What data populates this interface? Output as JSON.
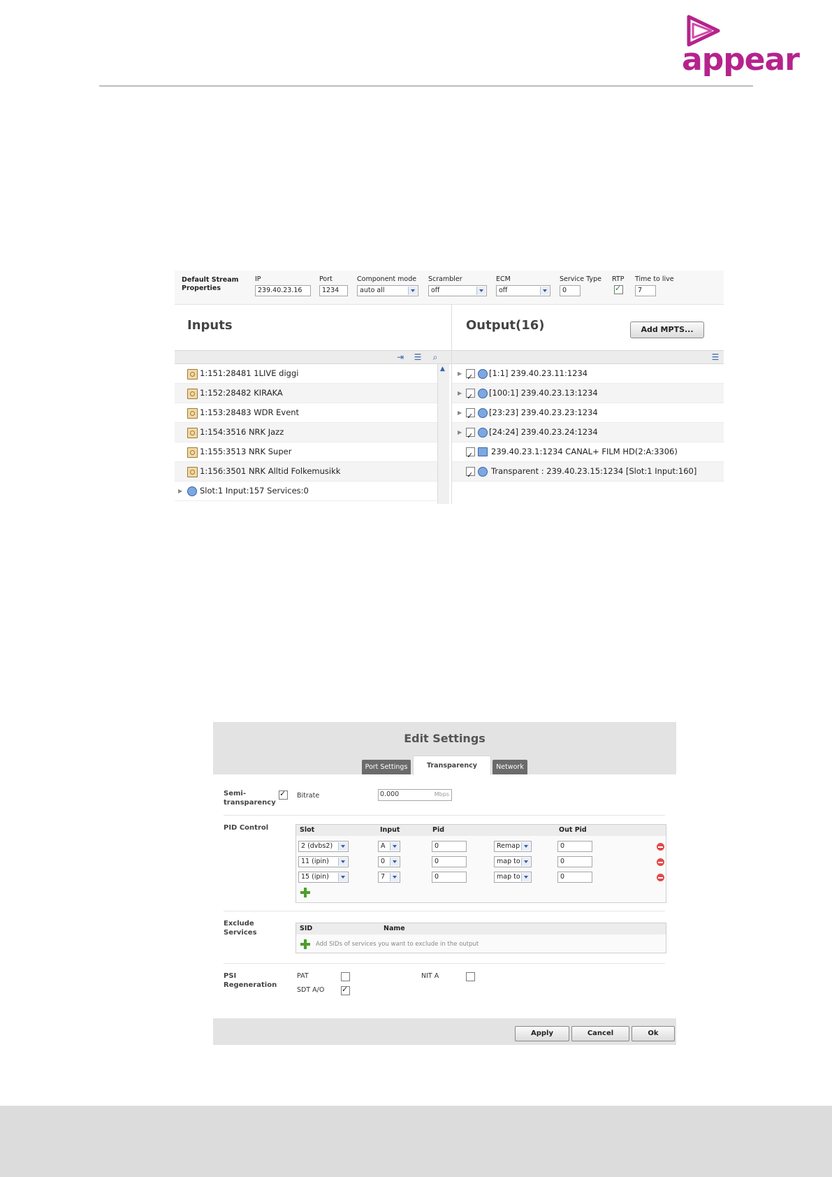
{
  "header": {
    "logo_text": "appear",
    "brand_color": "#b5238c"
  },
  "stream_panel": {
    "dsp_title": "Default Stream Properties",
    "fields": {
      "ip": {
        "label": "IP",
        "value": "239.40.23.16"
      },
      "port": {
        "label": "Port",
        "value": "1234"
      },
      "component_mode": {
        "label": "Component mode",
        "value": "auto all"
      },
      "scrambler": {
        "label": "Scrambler",
        "value": "off"
      },
      "ecm": {
        "label": "ECM",
        "value": "off"
      },
      "service_type": {
        "label": "Service Type",
        "value": "0"
      },
      "rtp": {
        "label": "RTP",
        "checked": true
      },
      "ttl": {
        "label": "Time to live",
        "value": "7"
      }
    },
    "inputs_title": "Inputs",
    "output_title": "Output(16)",
    "add_mpts_label": "Add MPTS...",
    "inputs": [
      "1:151:28481 1LIVE diggi",
      "1:152:28482 KIRAKA",
      "1:153:28483 WDR Event",
      "1:154:3516 NRK Jazz",
      "1:155:3513 NRK Super",
      "1:156:3501 NRK Alltid Folkemusikk",
      "Slot:1 Input:157 Services:0"
    ],
    "outputs": [
      "[1:1] 239.40.23.11:1234",
      "[100:1] 239.40.23.13:1234",
      "[23:23] 239.40.23.23:1234",
      "[24:24] 239.40.23.24:1234",
      "239.40.23.1:1234 CANAL+ FILM HD(2:A:3306)",
      "Transparent : 239.40.23.15:1234 [Slot:1 Input:160]"
    ]
  },
  "edit_settings": {
    "title": "Edit Settings",
    "tabs": [
      "Port Settings",
      "Transparency",
      "Network"
    ],
    "semi_label": "Semi- transparency",
    "semi_checked": true,
    "bitrate_label": "Bitrate",
    "bitrate_value": "0.000",
    "bitrate_unit": "Mbps",
    "pid_label": "PID Control",
    "pid_headers": [
      "Slot",
      "Input",
      "Pid",
      "Out Pid"
    ],
    "pid_rows": [
      {
        "slot": "2 (dvbs2)",
        "input": "A",
        "pid": "0",
        "mode": "Remap",
        "out": "0"
      },
      {
        "slot": "11 (ipin)",
        "input": "0",
        "pid": "0",
        "mode": "map to",
        "out": "0"
      },
      {
        "slot": "15 (ipin)",
        "input": "7",
        "pid": "0",
        "mode": "map to",
        "out": "0"
      }
    ],
    "exclude_label": "Exclude Services",
    "exclude_headers": [
      "SID",
      "Name"
    ],
    "exclude_hint": "Add SIDs of services you want to exclude in the output",
    "psi_label": "PSI Regeneration",
    "psi": {
      "pat": "PAT",
      "nit": "NIT A",
      "sdt": "SDT A/O"
    },
    "buttons": {
      "apply": "Apply",
      "cancel": "Cancel",
      "ok": "Ok"
    }
  }
}
